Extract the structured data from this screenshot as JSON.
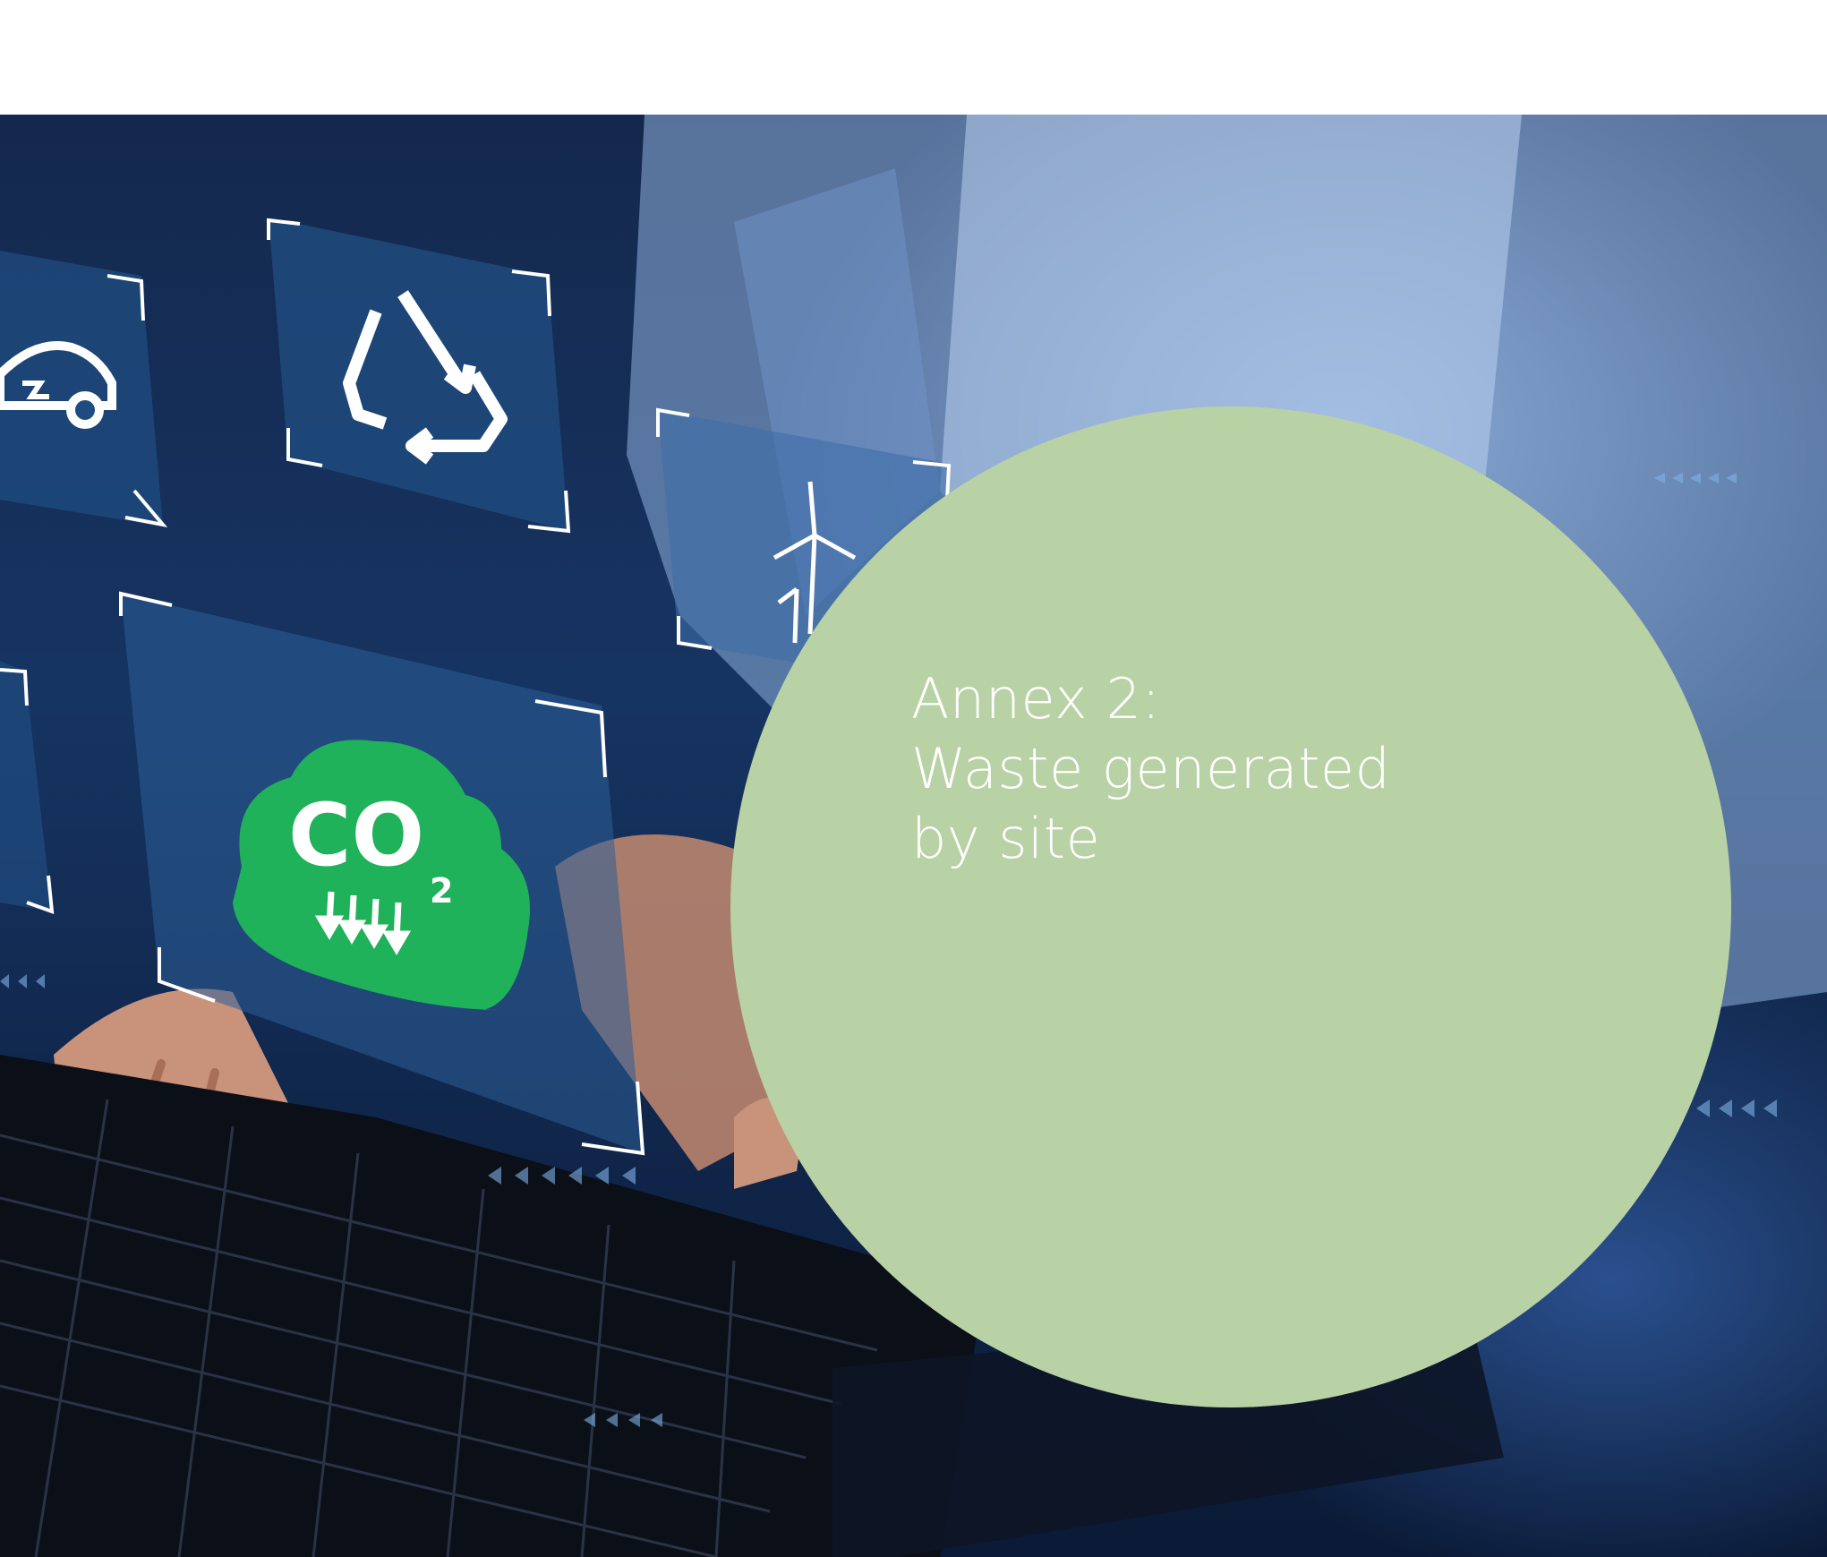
{
  "title": {
    "line1": "Annex 2:",
    "line2": "Waste generated",
    "line3": "by site"
  },
  "photo": {
    "cloud_label": "CO",
    "cloud_subscript": "2",
    "icons": [
      "car-electric-icon",
      "recycle-icon",
      "wind-turbine-icon",
      "co2-cloud-icon"
    ]
  },
  "colors": {
    "circle": "#b8d1a5",
    "cloud": "#1fb25a",
    "background": "#14284d"
  }
}
